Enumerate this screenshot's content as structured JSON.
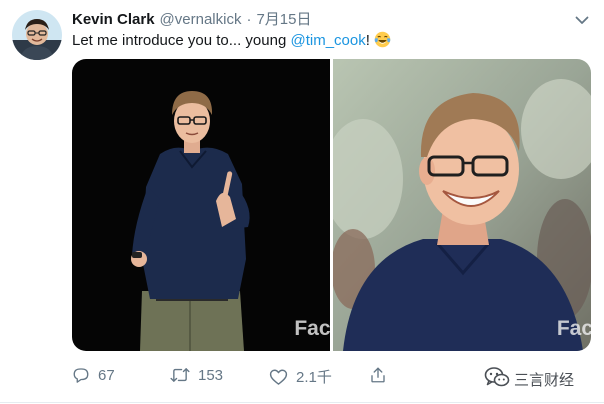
{
  "tweet": {
    "author_name": "Kevin Clark",
    "author_handle": "@vernalkick",
    "separator": "·",
    "date": "7月15日",
    "text_prefix": "Let me introduce you to... young ",
    "mention": "@tim_cook",
    "text_suffix": "!",
    "emoji": "face-with-tears-of-joy"
  },
  "media": {
    "watermark": "Fac"
  },
  "actions": {
    "reply_count": "67",
    "retweet_count": "153",
    "like_count": "2.1千",
    "share_label": ""
  },
  "source_badge": {
    "label": "三言财经",
    "icon": "wechat-icon"
  },
  "colors": {
    "link": "#1b95e0",
    "secondary_text": "#657786",
    "primary_text": "#14171a"
  }
}
